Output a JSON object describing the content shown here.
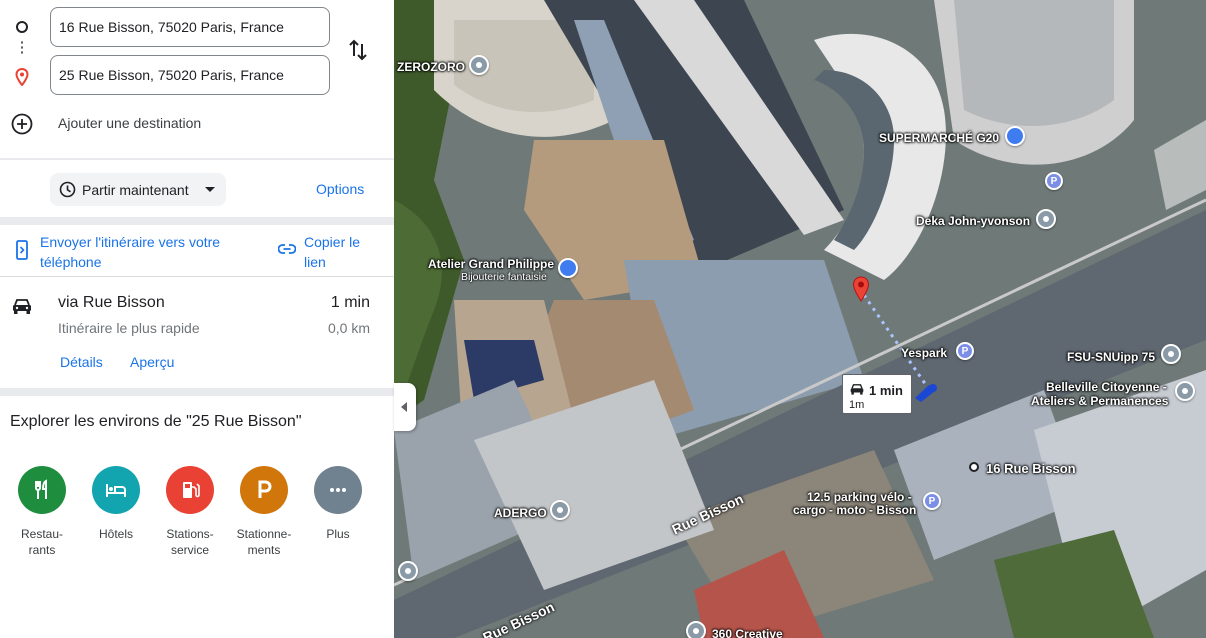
{
  "directions": {
    "origin_value": "16 Rue Bisson, 75020 Paris, France",
    "destination_value": "25 Rue Bisson, 75020 Paris, France",
    "add_destination_label": "Ajouter une destination",
    "swap_icon": "swap-vertical-icon"
  },
  "controls": {
    "depart_label": "Partir maintenant",
    "options_label": "Options"
  },
  "share": {
    "send_label": "Envoyer l'itinéraire vers votre téléphone",
    "copy_link_label": "Copier le lien"
  },
  "route": {
    "via": "via Rue Bisson",
    "time": "1 min",
    "description": "Itinéraire le plus rapide",
    "distance": "0,0 km",
    "details_label": "Détails",
    "preview_label": "Aperçu"
  },
  "explore": {
    "title": "Explorer les environs de \"25 Rue Bisson\"",
    "categories": [
      {
        "label": "Restau-\nrants",
        "color": "#1e8e3e",
        "icon": "restaurant-icon"
      },
      {
        "label": "Hôtels",
        "color": "#12a4af",
        "icon": "hotel-icon"
      },
      {
        "label": "Stations-\nservice",
        "color": "#e94235",
        "icon": "gas-station-icon"
      },
      {
        "label": "Stationne-\nments",
        "color": "#d0760b",
        "icon": "parking-icon"
      },
      {
        "label": "Plus",
        "color": "#70818f",
        "icon": "more-icon"
      }
    ]
  },
  "map": {
    "pois": {
      "zerozoro": "ZEROZORO",
      "supermarche": "SUPERMARCHÉ G20",
      "deka": "Deka John-yvonson",
      "atelier": "Atelier Grand Philippe",
      "atelier_sub": "Bijouterie fantaisie",
      "yespark": "Yespark",
      "fsu": "FSU-SNUipp 75",
      "belleville_1": "Belleville Citoyenne -",
      "belleville_2": "Ateliers & Permanences",
      "adergo": "ADERGO",
      "parking_velo_1": "12.5 parking vélo -",
      "parking_velo_2": "cargo - moto - Bisson",
      "origin_label": "16 Rue Bisson",
      "creative": "360 Creative",
      "street_1": "Rue Bisson",
      "street_2": "Rue Bisson",
      "parking_letter": "P"
    },
    "route_badge": {
      "time": "1 min",
      "distance": "1m"
    }
  }
}
